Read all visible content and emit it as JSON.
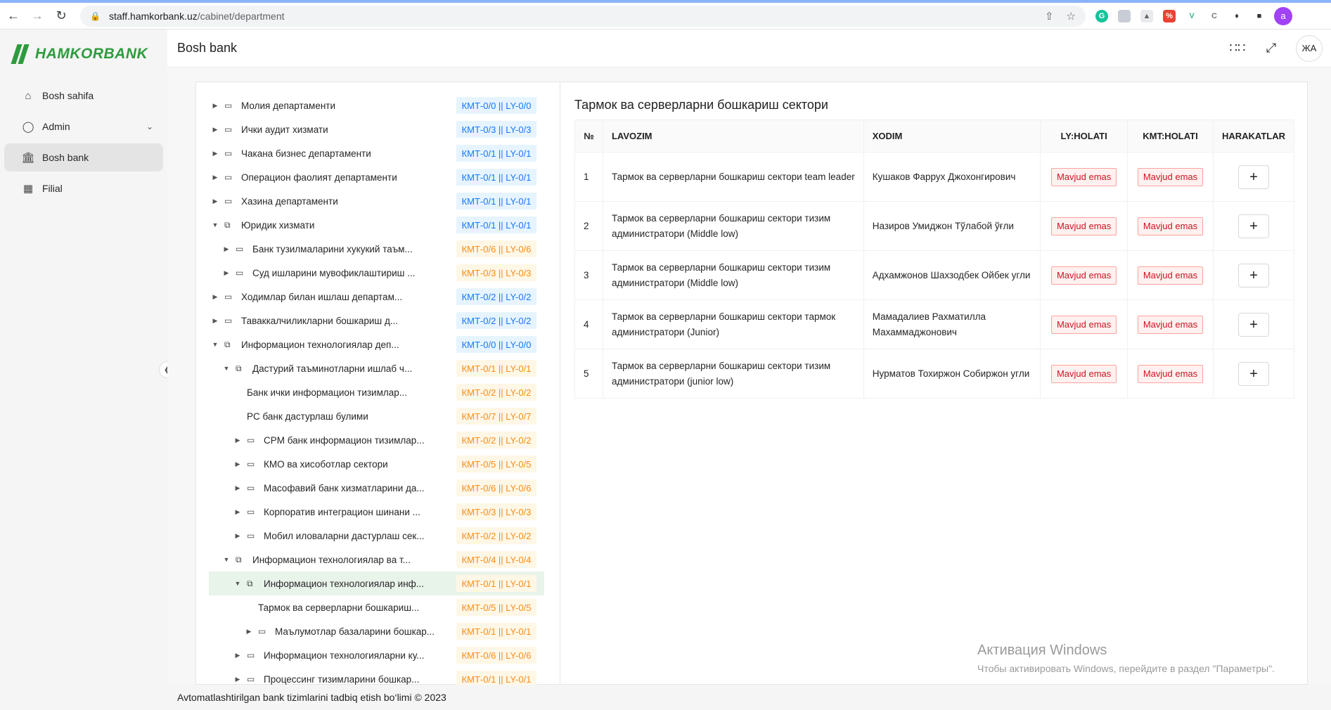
{
  "browser": {
    "url_domain": "staff.hamkorbank.uz",
    "url_path": "/cabinet/department",
    "profile_initial": "a"
  },
  "sidebar": {
    "logo_text": "HAMKORBANK",
    "brand_color": "#2e9b3e",
    "items": [
      {
        "label": "Bosh sahifa",
        "icon": "home-icon"
      },
      {
        "label": "Admin",
        "icon": "shield-icon"
      },
      {
        "label": "Bosh bank",
        "icon": "bank-icon"
      },
      {
        "label": "Filial",
        "icon": "building-icon"
      }
    ]
  },
  "header": {
    "title": "Bosh bank",
    "avatar_initials": "ЖА"
  },
  "tree": [
    {
      "label": "Молия департаменти",
      "tag": "КМТ-0/0 || LY-0/0",
      "tag_color": "blue",
      "level": 0,
      "caret": "right",
      "icon": "folder"
    },
    {
      "label": "Ички аудит хизмати",
      "tag": "КМТ-0/3 || LY-0/3",
      "tag_color": "blue",
      "level": 0,
      "caret": "right",
      "icon": "folder"
    },
    {
      "label": "Чакана бизнес департаменти",
      "tag": "КМТ-0/1 || LY-0/1",
      "tag_color": "blue",
      "level": 0,
      "caret": "right",
      "icon": "folder"
    },
    {
      "label": "Операцион фаолият департаменти",
      "tag": "КМТ-0/1 || LY-0/1",
      "tag_color": "blue",
      "level": 0,
      "caret": "right",
      "icon": "folder"
    },
    {
      "label": "Хазина департаменти",
      "tag": "КМТ-0/1 || LY-0/1",
      "tag_color": "blue",
      "level": 0,
      "caret": "right",
      "icon": "folder"
    },
    {
      "label": "Юридик хизмати",
      "tag": "КМТ-0/1 || LY-0/1",
      "tag_color": "blue",
      "level": 0,
      "caret": "down",
      "icon": "folder-open"
    },
    {
      "label": "Банк тузилмаларини хукукий таъм...",
      "tag": "КМТ-0/6 || LY-0/6",
      "tag_color": "orange",
      "level": 1,
      "caret": "right",
      "icon": "folder"
    },
    {
      "label": "Суд ишларини мувофиклаштириш ...",
      "tag": "КМТ-0/3 || LY-0/3",
      "tag_color": "orange",
      "level": 1,
      "caret": "right",
      "icon": "folder"
    },
    {
      "label": "Ходимлар билан ишлаш департам...",
      "tag": "КМТ-0/2 || LY-0/2",
      "tag_color": "blue",
      "level": 0,
      "caret": "right",
      "icon": "folder"
    },
    {
      "label": "Таваккалчиликларни бошкариш д...",
      "tag": "КМТ-0/2 || LY-0/2",
      "tag_color": "blue",
      "level": 0,
      "caret": "right",
      "icon": "folder"
    },
    {
      "label": "Информацион технологиялар деп...",
      "tag": "КМТ-0/0 || LY-0/0",
      "tag_color": "blue",
      "level": 0,
      "caret": "down",
      "icon": "folder-open"
    },
    {
      "label": "Дастурий таъминотларни ишлаб ч...",
      "tag": "КМТ-0/1 || LY-0/1",
      "tag_color": "orange",
      "level": 1,
      "caret": "down",
      "icon": "folder-open"
    },
    {
      "label": "Банк ички информацион тизимлар...",
      "tag": "КМТ-0/2 || LY-0/2",
      "tag_color": "orange",
      "level": 2,
      "caret": "none",
      "icon": "none"
    },
    {
      "label": "PC банк дастурлаш булими",
      "tag": "КМТ-0/7 || LY-0/7",
      "tag_color": "orange",
      "level": 2,
      "caret": "none",
      "icon": "none"
    },
    {
      "label": "CPM банк информацион тизимлар...",
      "tag": "КМТ-0/2 || LY-0/2",
      "tag_color": "orange",
      "level": 2,
      "caret": "right",
      "icon": "folder"
    },
    {
      "label": "КМО ва хисоботлар сектори",
      "tag": "КМТ-0/5 || LY-0/5",
      "tag_color": "orange",
      "level": 2,
      "caret": "right",
      "icon": "folder"
    },
    {
      "label": "Масофавий банк хизматларини да...",
      "tag": "КМТ-0/6 || LY-0/6",
      "tag_color": "orange",
      "level": 2,
      "caret": "right",
      "icon": "folder"
    },
    {
      "label": "Корпоратив интеграцион шинани ...",
      "tag": "КМТ-0/3 || LY-0/3",
      "tag_color": "orange",
      "level": 2,
      "caret": "right",
      "icon": "folder"
    },
    {
      "label": "Мобил иловаларни дастурлаш сек...",
      "tag": "КМТ-0/2 || LY-0/2",
      "tag_color": "orange",
      "level": 2,
      "caret": "right",
      "icon": "folder"
    },
    {
      "label": "Информацион технологиялар ва т...",
      "tag": "КМТ-0/4 || LY-0/4",
      "tag_color": "orange",
      "level": 1,
      "caret": "down",
      "icon": "folder-open"
    },
    {
      "label": "Информацион технологиялар инф...",
      "tag": "КМТ-0/1 || LY-0/1",
      "tag_color": "orange",
      "level": 2,
      "caret": "down",
      "icon": "folder-open",
      "selected": true
    },
    {
      "label": "Тармок ва серверларни бошкариш...",
      "tag": "КМТ-0/5 || LY-0/5",
      "tag_color": "orange",
      "level": 3,
      "caret": "none",
      "icon": "none"
    },
    {
      "label": "Маълумотлар базаларини бошкар...",
      "tag": "КМТ-0/1 || LY-0/1",
      "tag_color": "orange",
      "level": 3,
      "caret": "right",
      "icon": "folder"
    },
    {
      "label": "Информацион технологияларни ку...",
      "tag": "КМТ-0/6 || LY-0/6",
      "tag_color": "orange",
      "level": 2,
      "caret": "right",
      "icon": "folder"
    },
    {
      "label": "Процессинг тизимларини бошкар...",
      "tag": "КМТ-0/1 || LY-0/1",
      "tag_color": "orange",
      "level": 2,
      "caret": "right",
      "icon": "folder"
    }
  ],
  "sector": {
    "title": "Тармок ва серверларни бошкариш сектори",
    "columns": [
      "№",
      "LAVOZIM",
      "XODIM",
      "LY:HOLATI",
      "KMT:HOLATI",
      "HARAKATLAR"
    ],
    "rows": [
      {
        "n": "1",
        "lavozim": "Тармок ва серверларни бошкариш сектори team leader",
        "xodim": "Кушаков Фаррух Джохонгирович",
        "ly": "Mavjud emas",
        "kmt": "Mavjud emas"
      },
      {
        "n": "2",
        "lavozim": "Тармок ва серверларни бошкариш сектори тизим администратори (Middle low)",
        "xodim": "Назиров Умиджон Тўлабой ўғли",
        "ly": "Mavjud emas",
        "kmt": "Mavjud emas"
      },
      {
        "n": "3",
        "lavozim": "Тармок ва серверларни бошкариш сектори тизим администратори (Middle low)",
        "xodim": "Адхамжонов Шахзодбек Ойбек угли",
        "ly": "Mavjud emas",
        "kmt": "Mavjud emas"
      },
      {
        "n": "4",
        "lavozim": "Тармок ва серверларни бошкариш сектори тармок администратори (Junior)",
        "xodim": "Мамадалиев Рахматилла Махаммаджонович",
        "ly": "Mavjud emas",
        "kmt": "Mavjud emas"
      },
      {
        "n": "5",
        "lavozim": "Тармок ва серверларни бошкариш сектори тизим администратори (junior low)",
        "xodim": "Нурматов Тохиржон Собиржон угли",
        "ly": "Mavjud emas",
        "kmt": "Mavjud emas"
      }
    ]
  },
  "watermark": {
    "line1": "Активация Windows",
    "line2": "Чтобы активировать Windows, перейдите в раздел \"Параметры\"."
  },
  "footer": {
    "text": "Avtomatlashtirilgan bank tizimlarini tadbiq etish bo‘limi © 2023"
  }
}
